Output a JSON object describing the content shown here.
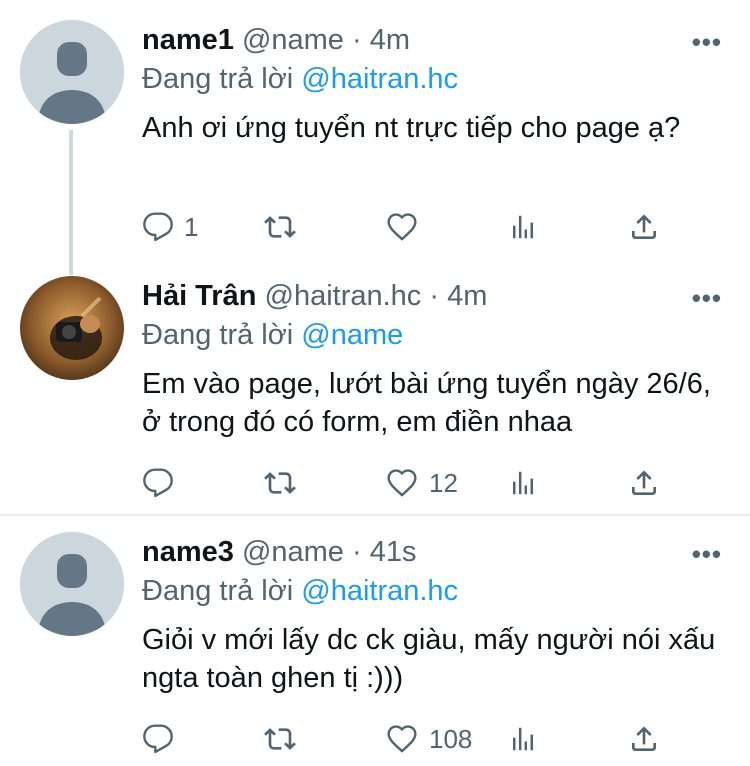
{
  "tweets": [
    {
      "name": "name1",
      "handle": "@name",
      "sep": "·",
      "time": "4m",
      "reply_prefix": "Đang trả lời",
      "reply_to": "@haitran.hc",
      "text": "Anh ơi ứng tuyển nt trực tiếp cho page ạ?",
      "counts": {
        "reply": "1",
        "retweet": "",
        "like": ""
      },
      "more": "•••"
    },
    {
      "name": "Hải Trân",
      "handle": "@haitran.hc",
      "sep": "·",
      "time": "4m",
      "reply_prefix": "Đang trả lời",
      "reply_to": "@name",
      "text": "Em vào page, lướt bài ứng tuyển ngày 26/6, ở trong đó có form, em điền nhaa",
      "counts": {
        "reply": "",
        "retweet": "",
        "like": "12"
      },
      "more": "•••"
    },
    {
      "name": "name3",
      "handle": "@name",
      "sep": "·",
      "time": "41s",
      "reply_prefix": "Đang trả lời",
      "reply_to": "@haitran.hc",
      "text": "Giỏi v mới lấy dc ck giàu, mấy người nói xấu ngta toàn ghen tị :)))",
      "counts": {
        "reply": "",
        "retweet": "",
        "like": "108"
      },
      "more": "•••"
    }
  ],
  "icons": {
    "reply": "reply-icon",
    "retweet": "retweet-icon",
    "like": "heart-icon",
    "views": "views-icon",
    "share": "share-icon",
    "more": "more-icon"
  },
  "colors": {
    "link": "#1d9bf0",
    "muted": "#536471",
    "text": "#0f1419",
    "avatar_default": "#ccd6dd"
  }
}
